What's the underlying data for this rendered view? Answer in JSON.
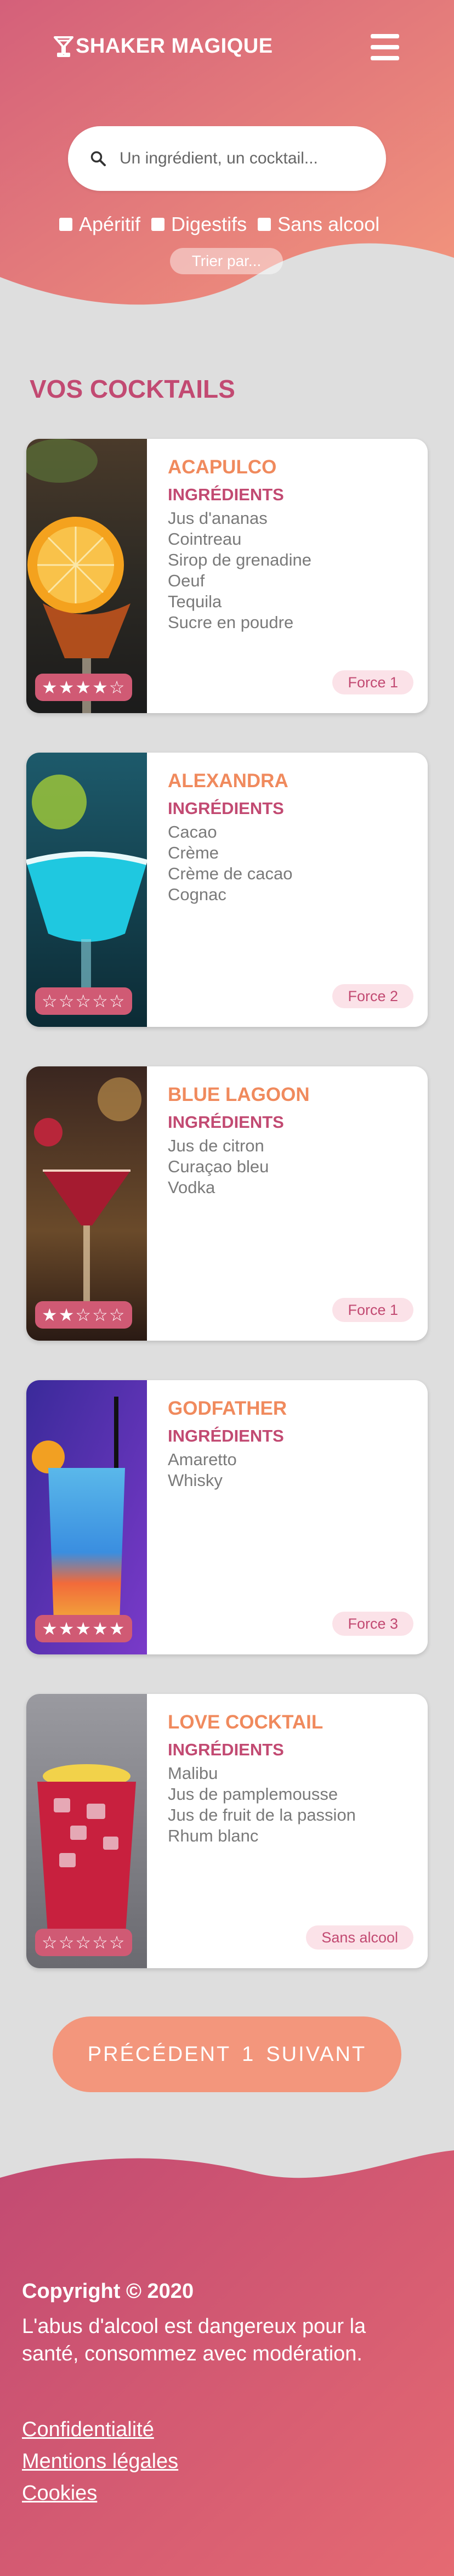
{
  "header": {
    "brand": "SHAKER MAGIQUE",
    "search_placeholder": "Un ingrédient, un cocktail...",
    "filters": [
      {
        "label": "Apéritif",
        "checked": false
      },
      {
        "label": "Digestifs",
        "checked": false
      },
      {
        "label": "Sans alcool",
        "checked": false
      }
    ],
    "sort_label": "Trier par..."
  },
  "section_title": "VOS COCKTAILS",
  "cocktails": [
    {
      "name": "ACAPULCO",
      "ingredients_title": "INGRÉDIENTS",
      "ingredients": [
        "Jus d'ananas",
        "Cointreau",
        "Sirop de grenadine",
        "Oeuf",
        "Tequila",
        "Sucre en poudre"
      ],
      "rating": 4,
      "rating_text": "★★★★☆",
      "badge": "Force 1"
    },
    {
      "name": "ALEXANDRA",
      "ingredients_title": "INGRÉDIENTS",
      "ingredients": [
        "Cacao",
        "Crème",
        "Crème de cacao",
        "Cognac"
      ],
      "rating": 0,
      "rating_text": "☆☆☆☆☆",
      "badge": "Force 2"
    },
    {
      "name": "BLUE LAGOON",
      "ingredients_title": "INGRÉDIENTS",
      "ingredients": [
        "Jus de citron",
        "Curaçao bleu",
        "Vodka"
      ],
      "rating": 2,
      "rating_text": "★★☆☆☆",
      "badge": "Force 1"
    },
    {
      "name": "GODFATHER",
      "ingredients_title": "INGRÉDIENTS",
      "ingredients": [
        "Amaretto",
        "Whisky"
      ],
      "rating": 5,
      "rating_text": "★★★★★",
      "badge": "Force 3"
    },
    {
      "name": "LOVE COCKTAIL",
      "ingredients_title": "INGRÉDIENTS",
      "ingredients": [
        "Malibu",
        "Jus de pamplemousse",
        "Jus de fruit de la passion",
        "Rhum blanc"
      ],
      "rating": 0,
      "rating_text": "☆☆☆☆☆",
      "badge": "Sans alcool"
    }
  ],
  "pagination": {
    "prev": "PRÉCÉDENT",
    "page": "1",
    "next": "SUIVANT"
  },
  "footer": {
    "copyright": "Copyright © 2020",
    "warning": "L'abus d'alcool est dangereux pour la santé, consommez avec modération.",
    "links": [
      "Confidentialité",
      "Mentions légales",
      "Cookies"
    ]
  },
  "colors": {
    "header_gradient_start": "#d4607a",
    "header_gradient_end": "#f3967c",
    "title": "#c24a72",
    "cocktail_name": "#f08a5d",
    "footer_gradient_start": "#c24a72",
    "footer_gradient_end": "#e56a72"
  }
}
